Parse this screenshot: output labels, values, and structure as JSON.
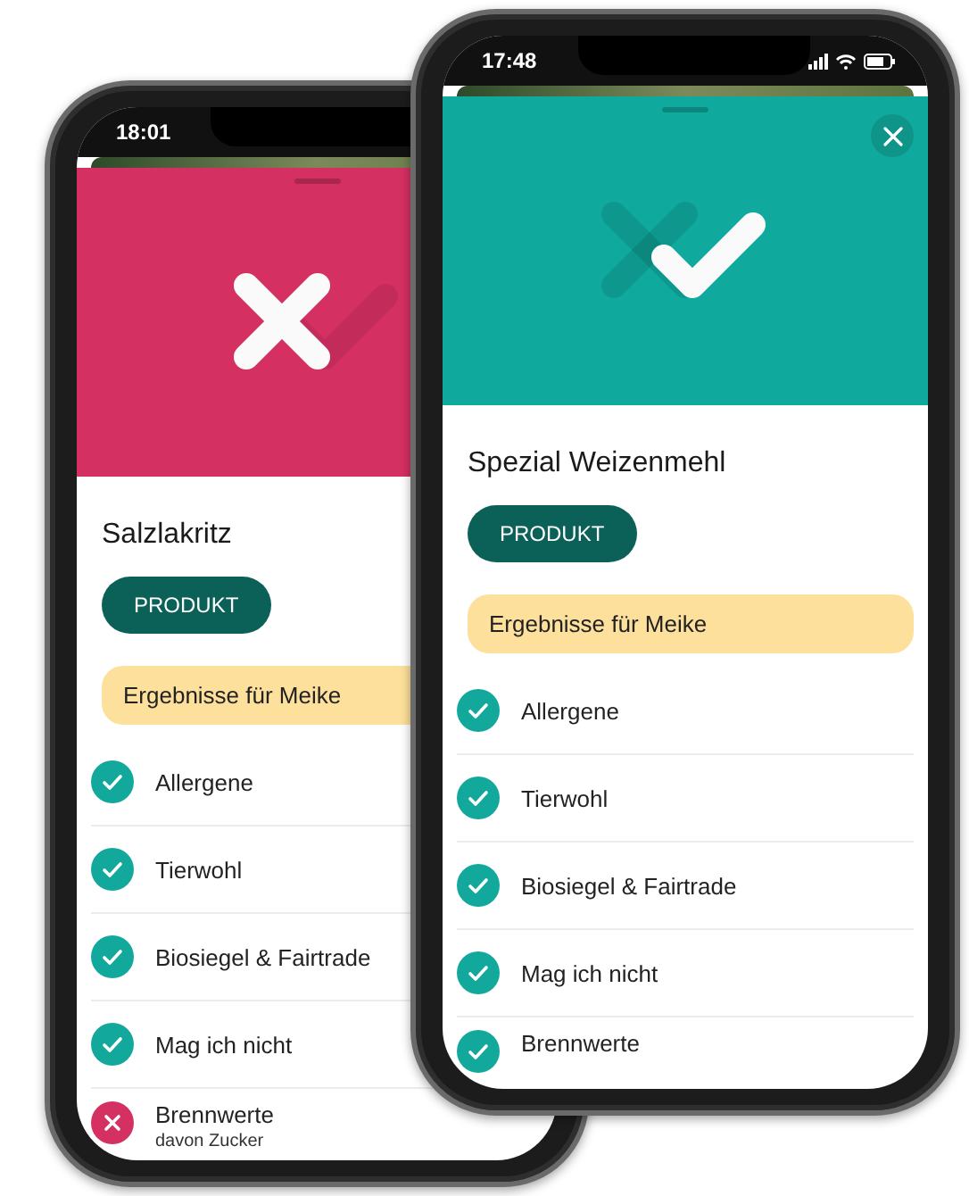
{
  "phones": [
    {
      "time": "18:01",
      "kind": "fail",
      "close_button": false,
      "status_icons": false,
      "product_name": "Salzlakritz",
      "product_button": "PRODUKT",
      "results_label": "Ergebnisse für Meike",
      "criteria": [
        {
          "label": "Allergene",
          "passed": true
        },
        {
          "label": "Tierwohl",
          "passed": true
        },
        {
          "label": "Biosiegel & Fairtrade",
          "passed": true
        },
        {
          "label": "Mag ich nicht",
          "passed": true
        },
        {
          "label": "Brennwerte",
          "detail": "davon Zucker",
          "passed": false
        }
      ]
    },
    {
      "time": "17:48",
      "kind": "pass",
      "close_button": true,
      "status_icons": true,
      "product_name": "Spezial Weizenmehl",
      "product_button": "PRODUKT",
      "results_label": "Ergebnisse für Meike",
      "criteria": [
        {
          "label": "Allergene",
          "passed": true
        },
        {
          "label": "Tierwohl",
          "passed": true
        },
        {
          "label": "Biosiegel & Fairtrade",
          "passed": true
        },
        {
          "label": "Mag ich nicht",
          "passed": true
        },
        {
          "label": "Brennwerte",
          "passed": true
        }
      ]
    }
  ]
}
